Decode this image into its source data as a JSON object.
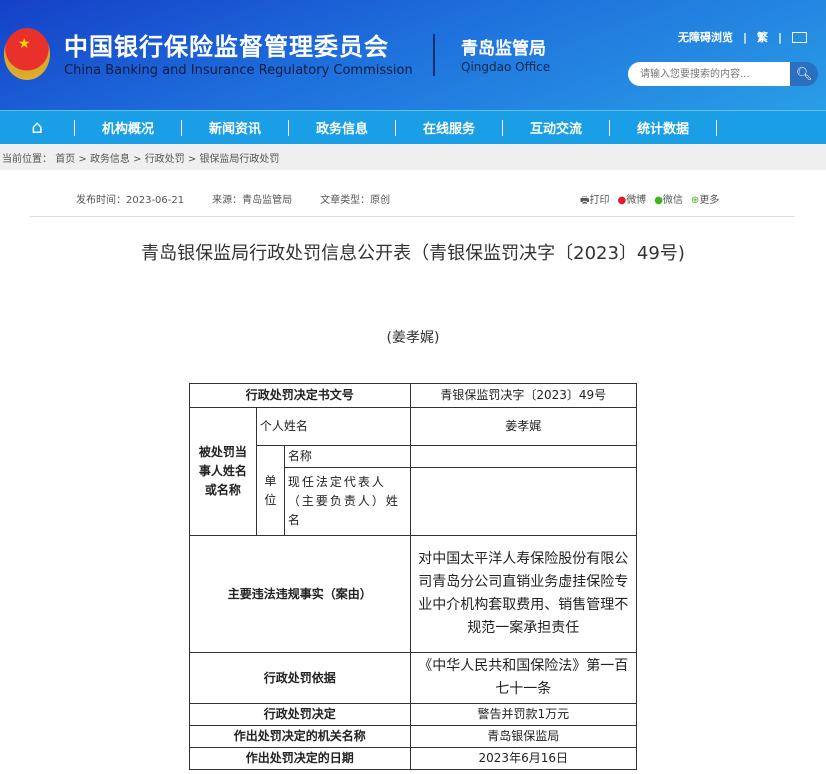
{
  "header": {
    "cn_title": "中国银行保险监督管理委员会",
    "en_title": "China Banking and Insurance Regulatory Commission",
    "office_cn": "青岛监管局",
    "office_en": "Qingdao Office",
    "accessibility": "无障碍浏览",
    "traditional": "繁",
    "search_placeholder": "请输入您要搜索的内容..."
  },
  "nav": [
    "机构概况",
    "新闻资讯",
    "政务信息",
    "在线服务",
    "互动交流",
    "统计数据"
  ],
  "breadcrumb": {
    "label": "当前位置：",
    "items": [
      "首页",
      "政务信息",
      "行政处罚",
      "银保监局行政处罚"
    ]
  },
  "meta": {
    "date": "发布时间：2023-06-21",
    "source": "来源：青岛监管局",
    "type": "文章类型：原创"
  },
  "share": {
    "print": "打印",
    "weibo": "微博",
    "wechat": "微信",
    "more": "更多"
  },
  "article": {
    "title": "青岛银保监局行政处罚信息公开表（青银保监罚决字〔2023〕49号)",
    "name": "(姜孝娓)"
  },
  "table": {
    "doc_no_label": "行政处罚决定书文号",
    "doc_no": "青银保监罚决字〔2023〕49号",
    "party_label": "被处罚当事人姓名或名称",
    "person_label": "个人姓名",
    "person": "姜孝娓",
    "unit_label": "单位",
    "unit_name_label": "名称",
    "unit_name": "",
    "rep_label": "现任法定代表人（主要负责人）姓名",
    "rep": "",
    "facts_label": "主要违法违规事实（案由）",
    "facts": "对中国太平洋人寿保险股份有限公司青岛分公司直销业务虚挂保险专业中介机构套取费用、销售管理不规范一案承担责任",
    "basis_label": "行政处罚依据",
    "basis": "《中华人民共和国保险法》第一百七十一条",
    "decision_label": "行政处罚决定",
    "decision": "警告并罚款1万元",
    "authority_label": "作出处罚决定的机关名称",
    "authority": "青岛银保监局",
    "date_label": "作出处罚决定的日期",
    "date": "2023年6月16日"
  }
}
